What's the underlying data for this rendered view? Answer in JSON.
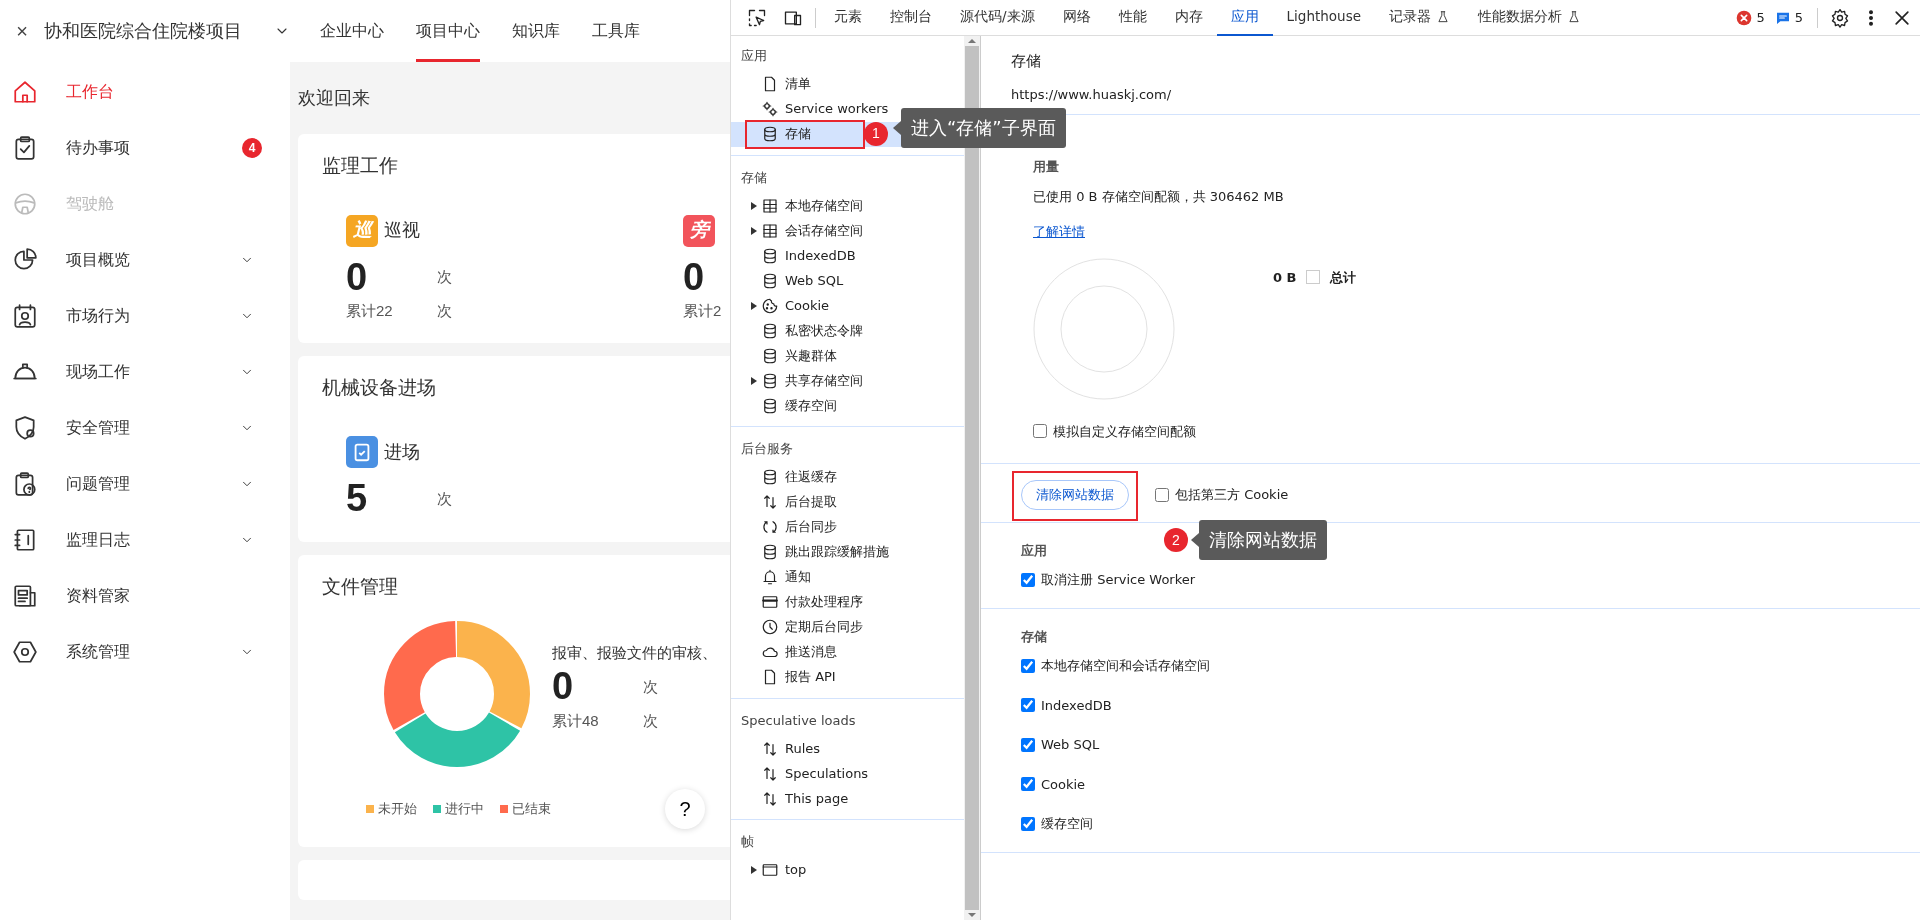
{
  "header": {
    "close": "×",
    "project": "协和医院综合住院楼项目",
    "nav": [
      {
        "label": "企业中心",
        "selected": false
      },
      {
        "label": "项目中心",
        "selected": true
      },
      {
        "label": "知识库",
        "selected": false
      },
      {
        "label": "工具库",
        "selected": false
      }
    ]
  },
  "sidebar": {
    "items": [
      {
        "label": "工作台",
        "kind": "home",
        "selected": true,
        "disabled": false,
        "expandable": false
      },
      {
        "label": "待办事项",
        "kind": "clipboard-check",
        "selected": false,
        "disabled": false,
        "expandable": false,
        "badge": "4"
      },
      {
        "label": "驾驶舱",
        "kind": "steering-wheel",
        "selected": false,
        "disabled": true,
        "expandable": false
      },
      {
        "label": "项目概览",
        "kind": "pie",
        "selected": false,
        "disabled": false,
        "expandable": true
      },
      {
        "label": "市场行为",
        "kind": "calendar-person",
        "selected": false,
        "disabled": false,
        "expandable": true
      },
      {
        "label": "现场工作",
        "kind": "helmet",
        "selected": false,
        "disabled": false,
        "expandable": true
      },
      {
        "label": "安全管理",
        "kind": "shield",
        "selected": false,
        "disabled": false,
        "expandable": true
      },
      {
        "label": "问题管理",
        "kind": "clipboard-question",
        "selected": false,
        "disabled": false,
        "expandable": true
      },
      {
        "label": "监理日志",
        "kind": "notebook",
        "selected": false,
        "disabled": false,
        "expandable": true
      },
      {
        "label": "资料管家",
        "kind": "document",
        "selected": false,
        "disabled": false,
        "expandable": false
      },
      {
        "label": "系统管理",
        "kind": "hexagon",
        "selected": false,
        "disabled": false,
        "expandable": true
      }
    ]
  },
  "main": {
    "welcome": "欢迎回来",
    "cards": [
      {
        "title": "监理工作",
        "kind": "metrics",
        "metrics": [
          {
            "icon_char": "巡",
            "color": "#f5a623",
            "label": "巡视",
            "value": "0",
            "unit": "次",
            "total": "累计22",
            "total_unit": "次"
          },
          {
            "icon_char": "旁",
            "color": "#f2545b",
            "value": "0",
            "total": "累计2"
          }
        ]
      },
      {
        "title": "机械设备进场",
        "kind": "metrics",
        "metrics": [
          {
            "color": "#4a90e2",
            "label": "进场",
            "value": "5",
            "unit": "次"
          }
        ]
      },
      {
        "title": "文件管理",
        "kind": "chart",
        "caption": "报审、报验文件的审核、",
        "value": "0",
        "unit": "次",
        "total": "累计48",
        "total_unit": "次",
        "legend": [
          {
            "label": "未开始",
            "color": "#fbb34c"
          },
          {
            "label": "进行中",
            "color": "#2ec3a6"
          },
          {
            "label": "已结束",
            "color": "#ff6a4d"
          }
        ],
        "help": "?"
      }
    ]
  },
  "devtools": {
    "tabs": [
      {
        "label": "元素",
        "selected": false,
        "experimental": false
      },
      {
        "label": "控制台",
        "selected": false,
        "experimental": false
      },
      {
        "label": "源代码/来源",
        "selected": false,
        "experimental": false
      },
      {
        "label": "网络",
        "selected": false,
        "experimental": false
      },
      {
        "label": "性能",
        "selected": false,
        "experimental": false
      },
      {
        "label": "内存",
        "selected": false,
        "experimental": false
      },
      {
        "label": "应用",
        "selected": true,
        "experimental": false
      },
      {
        "label": "Lighthouse",
        "selected": false,
        "experimental": false
      },
      {
        "label": "记录器",
        "selected": false,
        "experimental": true
      },
      {
        "label": "性能数据分析",
        "selected": false,
        "experimental": true
      }
    ],
    "errors": "5",
    "messages": "5",
    "tree": [
      {
        "title": "应用",
        "items": [
          {
            "label": "清单",
            "kind": "file",
            "expandable": false,
            "selected": false
          },
          {
            "label": "Service workers",
            "kind": "gears",
            "expandable": false,
            "selected": false
          },
          {
            "label": "存储",
            "kind": "database",
            "expandable": false,
            "selected": true,
            "annotation": {
              "number": "1",
              "text": "进入“存储”子界面"
            }
          }
        ]
      },
      {
        "title": "存储",
        "items": [
          {
            "label": "本地存储空间",
            "kind": "table",
            "expandable": true,
            "selected": false
          },
          {
            "label": "会话存储空间",
            "kind": "table",
            "expandable": true,
            "selected": false
          },
          {
            "label": "IndexedDB",
            "kind": "database",
            "expandable": false,
            "selected": false
          },
          {
            "label": "Web SQL",
            "kind": "database",
            "expandable": false,
            "selected": false
          },
          {
            "label": "Cookie",
            "kind": "cookie",
            "expandable": true,
            "selected": false
          },
          {
            "label": "私密状态令牌",
            "kind": "database",
            "expandable": false,
            "selected": false
          },
          {
            "label": "兴趣群体",
            "kind": "database",
            "expandable": false,
            "selected": false
          },
          {
            "label": "共享存储空间",
            "kind": "database",
            "expandable": true,
            "selected": false
          },
          {
            "label": "缓存空间",
            "kind": "database",
            "expandable": false,
            "selected": false
          }
        ]
      },
      {
        "title": "后台服务",
        "items": [
          {
            "label": "往返缓存",
            "kind": "database",
            "expandable": false,
            "selected": false
          },
          {
            "label": "后台提取",
            "kind": "arrows",
            "expandable": false,
            "selected": false
          },
          {
            "label": "后台同步",
            "kind": "sync",
            "expandable": false,
            "selected": false
          },
          {
            "label": "跳出跟踪缓解措施",
            "kind": "database",
            "expandable": false,
            "selected": false
          },
          {
            "label": "通知",
            "kind": "bell",
            "expandable": false,
            "selected": false
          },
          {
            "label": "付款处理程序",
            "kind": "card",
            "expandable": false,
            "selected": false
          },
          {
            "label": "定期后台同步",
            "kind": "clock",
            "expandable": false,
            "selected": false
          },
          {
            "label": "推送消息",
            "kind": "cloud",
            "expandable": false,
            "selected": false
          },
          {
            "label": "报告 API",
            "kind": "file",
            "expandable": false,
            "selected": false
          }
        ]
      },
      {
        "title": "Speculative loads",
        "items": [
          {
            "label": "Rules",
            "kind": "arrows",
            "expandable": false,
            "selected": false
          },
          {
            "label": "Speculations",
            "kind": "arrows",
            "expandable": false,
            "selected": false
          },
          {
            "label": "This page",
            "kind": "arrows",
            "expandable": false,
            "selected": false
          }
        ]
      },
      {
        "title": "帧",
        "items": [
          {
            "label": "top",
            "kind": "frame",
            "expandable": true,
            "selected": false
          }
        ]
      }
    ],
    "storage": {
      "title": "存储",
      "url": "https://www.huaskj.com/",
      "usage_heading": "用量",
      "usage_text": "已使用 0 B 存储空间配额，共 306462 MB",
      "learn_more": "了解详情",
      "legend_value": "0 B",
      "legend_label": "总计",
      "simulate": {
        "label": "模拟自定义存储空间配额",
        "checked": false
      },
      "clear_button": {
        "label": "清除网站数据",
        "annotation": {
          "number": "2",
          "text": "清除网站数据"
        }
      },
      "third_party": {
        "label": "包括第三方 Cookie",
        "checked": false
      },
      "sections": [
        {
          "title": "应用",
          "options": [
            {
              "label": "取消注册 Service Worker",
              "checked": true
            }
          ]
        },
        {
          "title": "存储",
          "options": [
            {
              "label": "本地存储空间和会话存储空间",
              "checked": true
            },
            {
              "label": "IndexedDB",
              "checked": true
            },
            {
              "label": "Web SQL",
              "checked": true
            },
            {
              "label": "Cookie",
              "checked": true
            },
            {
              "label": "缓存空间",
              "checked": true
            }
          ]
        }
      ]
    }
  }
}
